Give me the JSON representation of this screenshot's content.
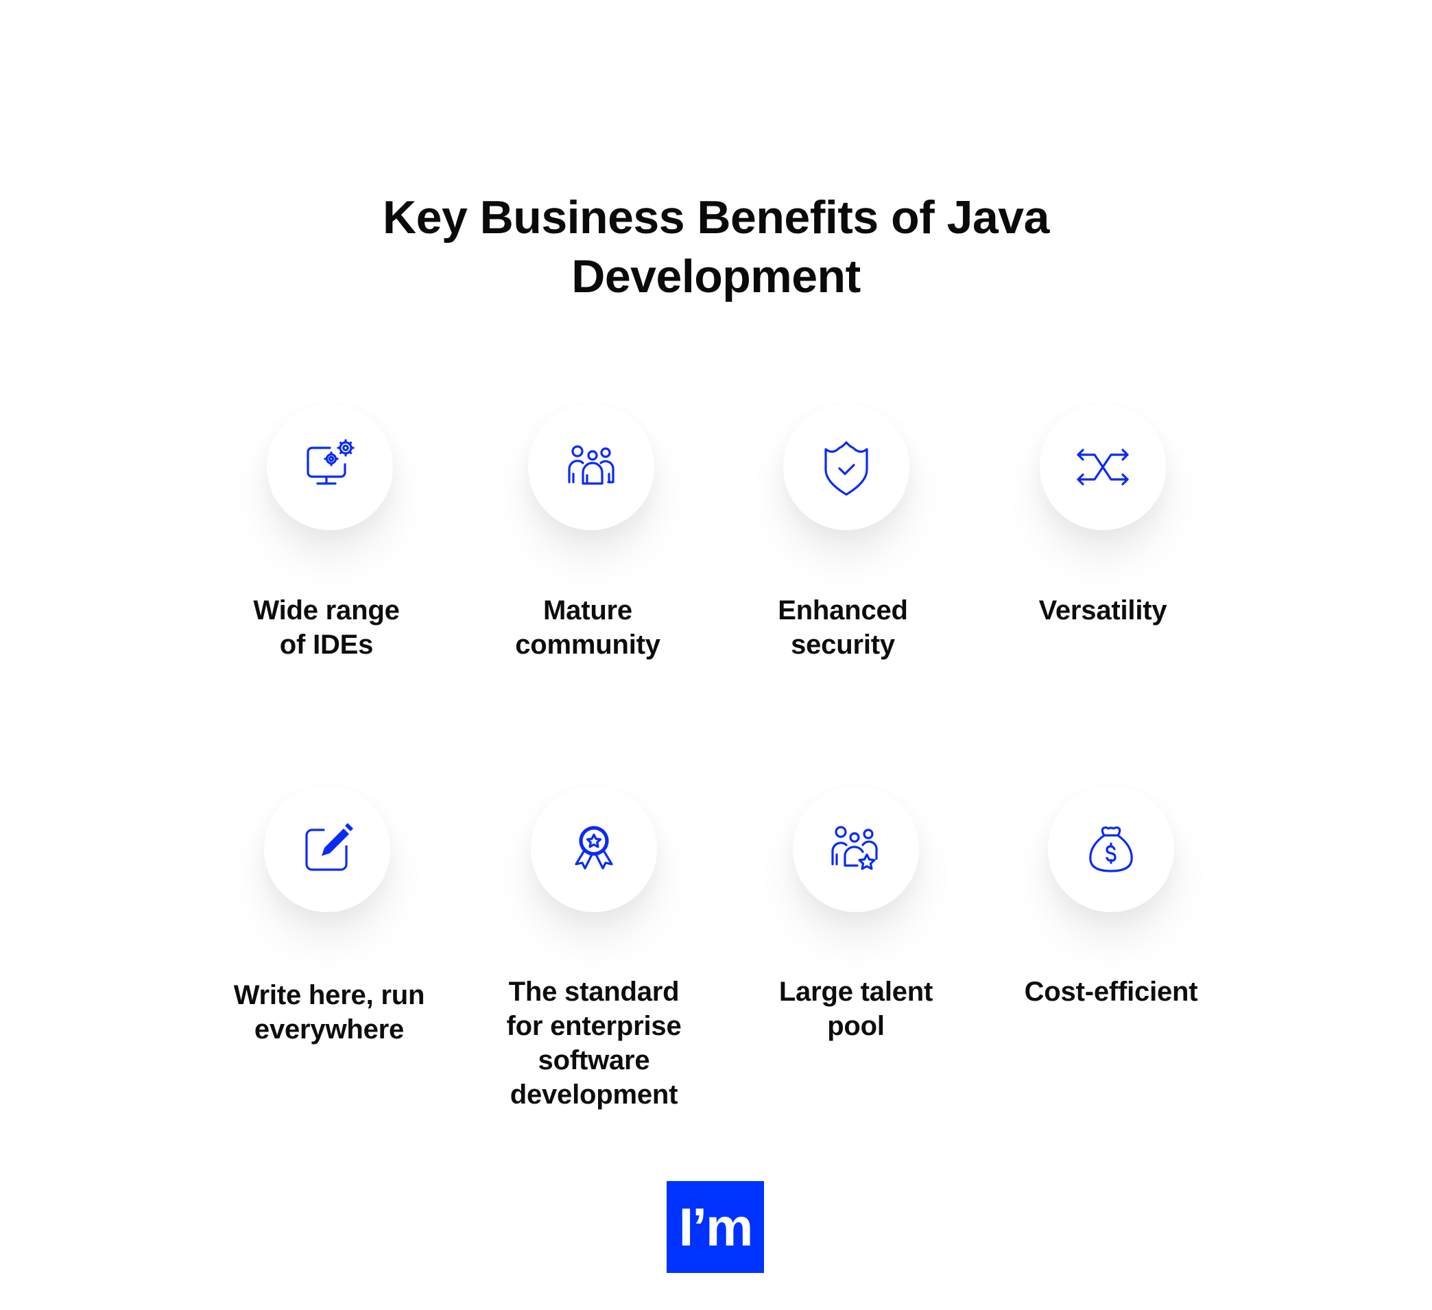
{
  "title": {
    "line1": "Key Business Benefits of Java",
    "line2": "Development"
  },
  "accent_color": "#0033ff",
  "benefits": [
    {
      "icon": "monitor-gears-icon",
      "lines": [
        "Wide range",
        "of IDEs"
      ]
    },
    {
      "icon": "community-group-icon",
      "lines": [
        "Mature",
        "community"
      ]
    },
    {
      "icon": "shield-check-icon",
      "lines": [
        "Enhanced",
        "security"
      ]
    },
    {
      "icon": "shuffle-arrows-icon",
      "lines": [
        "Versatility"
      ]
    },
    {
      "icon": "edit-pencil-icon",
      "lines": [
        "Write here, run",
        "everywhere"
      ]
    },
    {
      "icon": "award-ribbon-icon",
      "lines": [
        "The standard",
        "for enterprise",
        "software",
        "development"
      ]
    },
    {
      "icon": "talent-group-star-icon",
      "lines": [
        "Large talent",
        "pool"
      ]
    },
    {
      "icon": "money-bag-icon",
      "lines": [
        "Cost-efficient"
      ]
    }
  ],
  "logo": {
    "text": "I’m"
  }
}
